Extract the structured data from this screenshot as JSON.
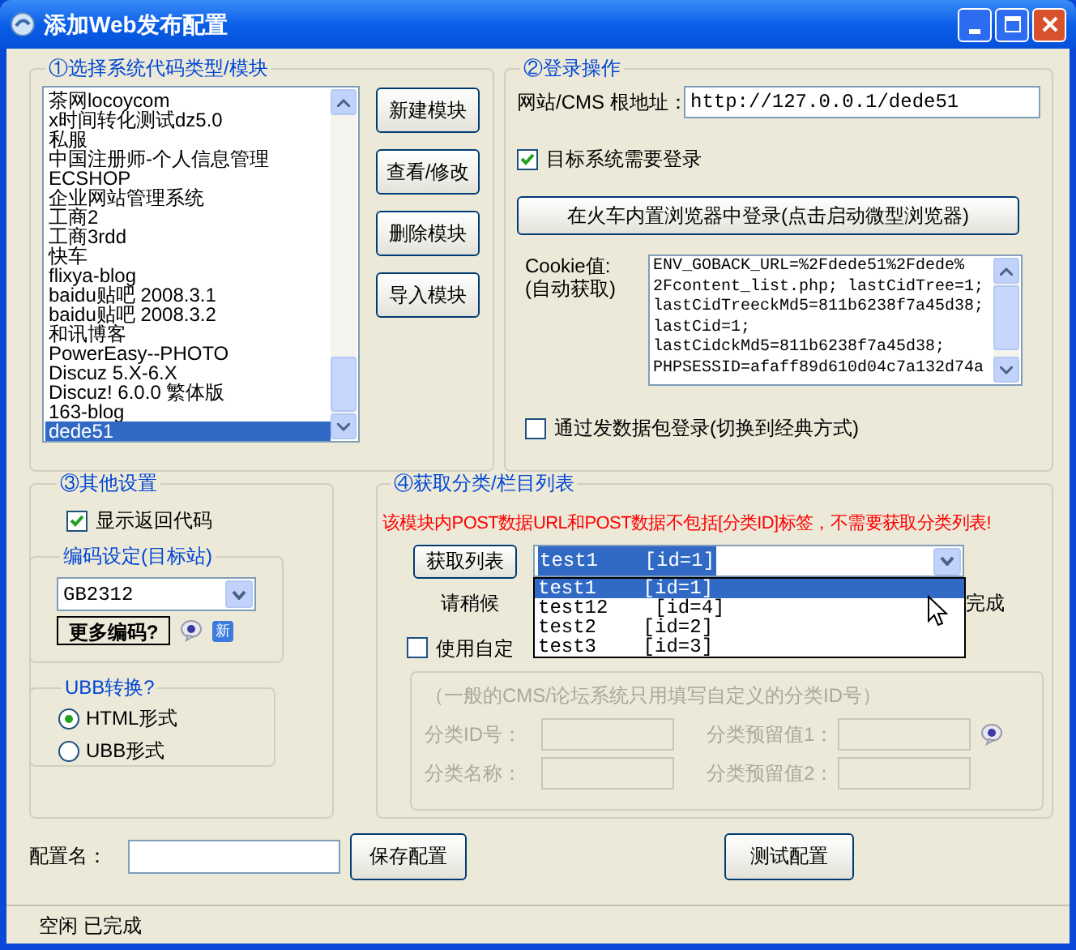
{
  "window": {
    "title": "添加Web发布配置"
  },
  "modules": {
    "title": "①选择系统代码类型/模块",
    "items": [
      {
        "label": "茶网locoycom",
        "selected": false
      },
      {
        "label": "x时间转化测试dz5.0",
        "selected": false
      },
      {
        "label": "私服",
        "selected": false
      },
      {
        "label": "中国注册师-个人信息管理",
        "selected": false
      },
      {
        "label": "ECSHOP",
        "selected": false
      },
      {
        "label": "企业网站管理系统",
        "selected": false
      },
      {
        "label": "工商2",
        "selected": false
      },
      {
        "label": "工商3rdd",
        "selected": false
      },
      {
        "label": "快车",
        "selected": false
      },
      {
        "label": "flixya-blog",
        "selected": false
      },
      {
        "label": "baidu贴吧 2008.3.1",
        "selected": false
      },
      {
        "label": "baidu贴吧 2008.3.2",
        "selected": false
      },
      {
        "label": "和讯博客",
        "selected": false
      },
      {
        "label": "PowerEasy--PHOTO",
        "selected": false
      },
      {
        "label": "Discuz 5.X-6.X",
        "selected": false
      },
      {
        "label": "Discuz! 6.0.0 繁体版",
        "selected": false
      },
      {
        "label": "163-blog",
        "selected": false
      },
      {
        "label": "dede51",
        "selected": true
      }
    ],
    "buttons": [
      "新建模块",
      "查看/修改",
      "删除模块",
      "导入模块"
    ]
  },
  "login": {
    "title": "②登录操作",
    "url_label": "网站/CMS 根地址：",
    "url_value": "http://127.0.0.1/dede51",
    "need_login": {
      "label": "目标系统需要登录",
      "checked": true
    },
    "browser_button": "在火车内置浏览器中登录(点击启动微型浏览器)",
    "cookie_label": "Cookie值:",
    "cookie_hint": "(自动获取)",
    "cookie_lines": [
      "ENV_GOBACK_URL=%2Fdede51%2Fdede%",
      "2Fcontent_list.php; lastCidTree=1;",
      "lastCidTreeckMd5=811b6238f7a45d38;",
      "lastCid=1;",
      "lastCidckMd5=811b6238f7a45d38;",
      "PHPSESSID=afaff89d610d04c7a132d74a"
    ],
    "packet_login": {
      "label": "通过发数据包登录(切换到经典方式)",
      "checked": false
    }
  },
  "other": {
    "title": "③其他设置",
    "show_code": {
      "label": "显示返回代码",
      "checked": true
    },
    "encoding": {
      "title": "编码设定(目标站)",
      "value": "GB2312",
      "more_button": "更多编码?",
      "new_badge": "新"
    },
    "ubb": {
      "title": "UBB转换?",
      "options": [
        {
          "label": "HTML形式",
          "selected": true
        },
        {
          "label": "UBB形式",
          "selected": false
        }
      ]
    }
  },
  "category": {
    "title": "④获取分类/栏目列表",
    "warning": "该模块内POST数据URL和POST数据不包括[分类ID]标签，不需要获取分类列表!",
    "fetch_button": "获取列表",
    "combo_value": "test1    [id=1]",
    "dropdown_items": [
      {
        "label": "test1    [id=1]",
        "selected": true
      },
      {
        "label": "test12    [id=4]",
        "selected": false
      },
      {
        "label": "test2    [id=2]",
        "selected": false
      },
      {
        "label": "test3    [id=3]",
        "selected": false
      }
    ],
    "wait_label": "请稍候",
    "done_label": "完成",
    "custom": {
      "label": "使用自定",
      "checked": false
    },
    "custom_group": {
      "note": "（一般的CMS/论坛系统只用填写自定义的分类ID号）",
      "fields": [
        "分类ID号：",
        "分类预留值1：",
        "分类名称：",
        "分类预留值2："
      ]
    }
  },
  "config_name_label": "配置名：",
  "save_button": "保存配置",
  "test_button": "测试配置",
  "status_bar": "空闲 已完成"
}
